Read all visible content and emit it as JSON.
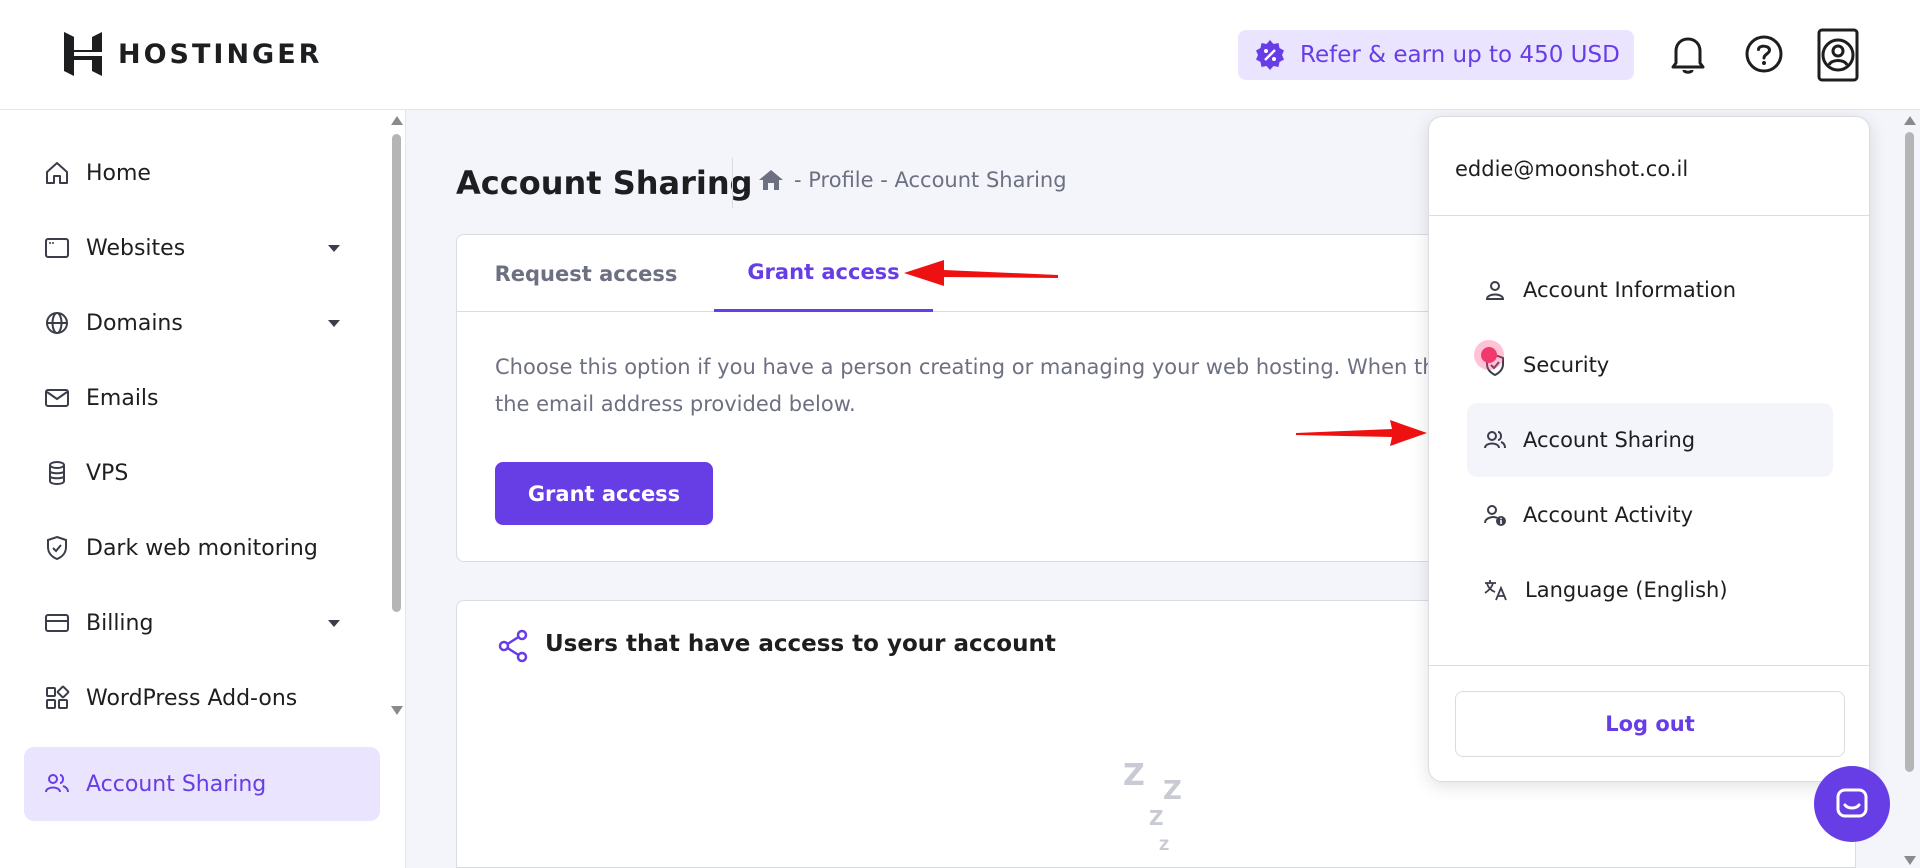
{
  "header": {
    "brand": "HOSTINGER",
    "refer_label": "Refer & earn up to 450 USD"
  },
  "sidebar": {
    "items": [
      {
        "label": "Home"
      },
      {
        "label": "Websites"
      },
      {
        "label": "Domains"
      },
      {
        "label": "Emails"
      },
      {
        "label": "VPS"
      },
      {
        "label": "Dark web monitoring"
      },
      {
        "label": "Billing"
      },
      {
        "label": "WordPress Add-ons"
      },
      {
        "label": "Account Sharing"
      }
    ]
  },
  "main": {
    "title": "Account Sharing",
    "breadcrumb": "- Profile - Account Sharing",
    "tabs": [
      {
        "label": "Request access"
      },
      {
        "label": "Grant access"
      }
    ],
    "description": "Choose this option if you have a person creating or managing your web hosting. When the ac confirmation email is sent to the email address provided below.",
    "grant_button": "Grant access",
    "users_title": "Users that have access to your account"
  },
  "dropdown": {
    "email": "eddie@moonshot.co.il",
    "items": [
      {
        "label": "Account Information"
      },
      {
        "label": "Security"
      },
      {
        "label": "Account Sharing"
      },
      {
        "label": "Account Activity"
      },
      {
        "label": "Language (English)"
      }
    ],
    "logout": "Log out"
  },
  "colors": {
    "brand_purple": "#673de6",
    "active_bg": "#ebe4ff",
    "annotation_red": "#ee1111"
  }
}
